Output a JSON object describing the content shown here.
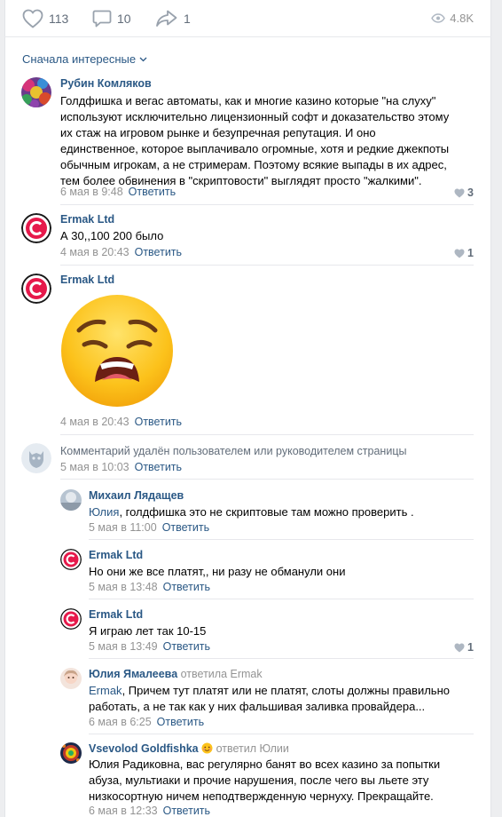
{
  "actions": {
    "likes": "113",
    "comments": "10",
    "shares": "1",
    "views": "4.8K"
  },
  "sort_label": "Сначала интересные",
  "comments": [
    {
      "author": "Рубин Комляков",
      "lines": [
        "Голдфишка и вегас автоматы, как и многие казино которые \"на слуху\"",
        "используют исключительно лицензионный софт и доказательство этому",
        "их стаж на игровом рынке и безупречная репутация. И оно",
        "единственное, которое выплачивало огромные, хотя и редкие джекпоты",
        "обычным игрокам, а не стримерам. Поэтому всякие выпады в их адрес,",
        "тем более обвинения в \"скриптовости\" выглядят просто \"жалкими\"."
      ],
      "date": "6 мая в 9:48",
      "reply": "Ответить",
      "likes": "3"
    },
    {
      "author": "Ermak Ltd",
      "text": "А 30,,100 200 было",
      "date": "4 мая в 20:43",
      "reply": "Ответить",
      "likes": "1"
    },
    {
      "author": "Ermak Ltd",
      "emoji": "weary-face",
      "date": "4 мая в 20:43",
      "reply": "Ответить"
    },
    {
      "deleted_text": "Комментарий удалён пользователем или руководителем страницы",
      "date": "5 мая в 10:03",
      "reply": "Ответить"
    }
  ],
  "replies": [
    {
      "author": "Михаил Лядащев",
      "mention": "Юлия",
      "text": ", голдфишка это не скриптовые там можно проверить .",
      "date": "5 мая в 11:00",
      "reply": "Ответить"
    },
    {
      "author": "Ermak Ltd",
      "text": "Но они же все платят,, ни разу не обманули они",
      "date": "5 мая в 13:48",
      "reply": "Ответить"
    },
    {
      "author": "Ermak Ltd",
      "text": "Я играю лет так 10-15",
      "date": "5 мая в 13:49",
      "reply": "Ответить",
      "likes": "1"
    },
    {
      "author": "Юлия Ямалеева",
      "relation": "ответила Ermak",
      "mention": "Ermak",
      "line1": ", Причем тут платят или не платят, слоты должны правильно",
      "line2": "работать, а не так как у них фальшивая заливка провайдера...",
      "date": "6 мая в 6:25",
      "reply": "Ответить"
    },
    {
      "author": "Vsevolod Goldfishka",
      "relation": "ответил Юлии",
      "lines": [
        "Юлия Радиковна, вас регулярно банят во всех казино за попытки",
        "абуза, мультиаки и прочие нарушения, после чего вы льете эту",
        "низкосортную ничем неподтвержденную чернуху. Прекращайте."
      ],
      "date": "6 мая в 12:33",
      "reply": "Ответить"
    }
  ],
  "colors": {
    "link": "#2a5885",
    "muted": "#939393",
    "ermak_red": "#e6194b"
  }
}
